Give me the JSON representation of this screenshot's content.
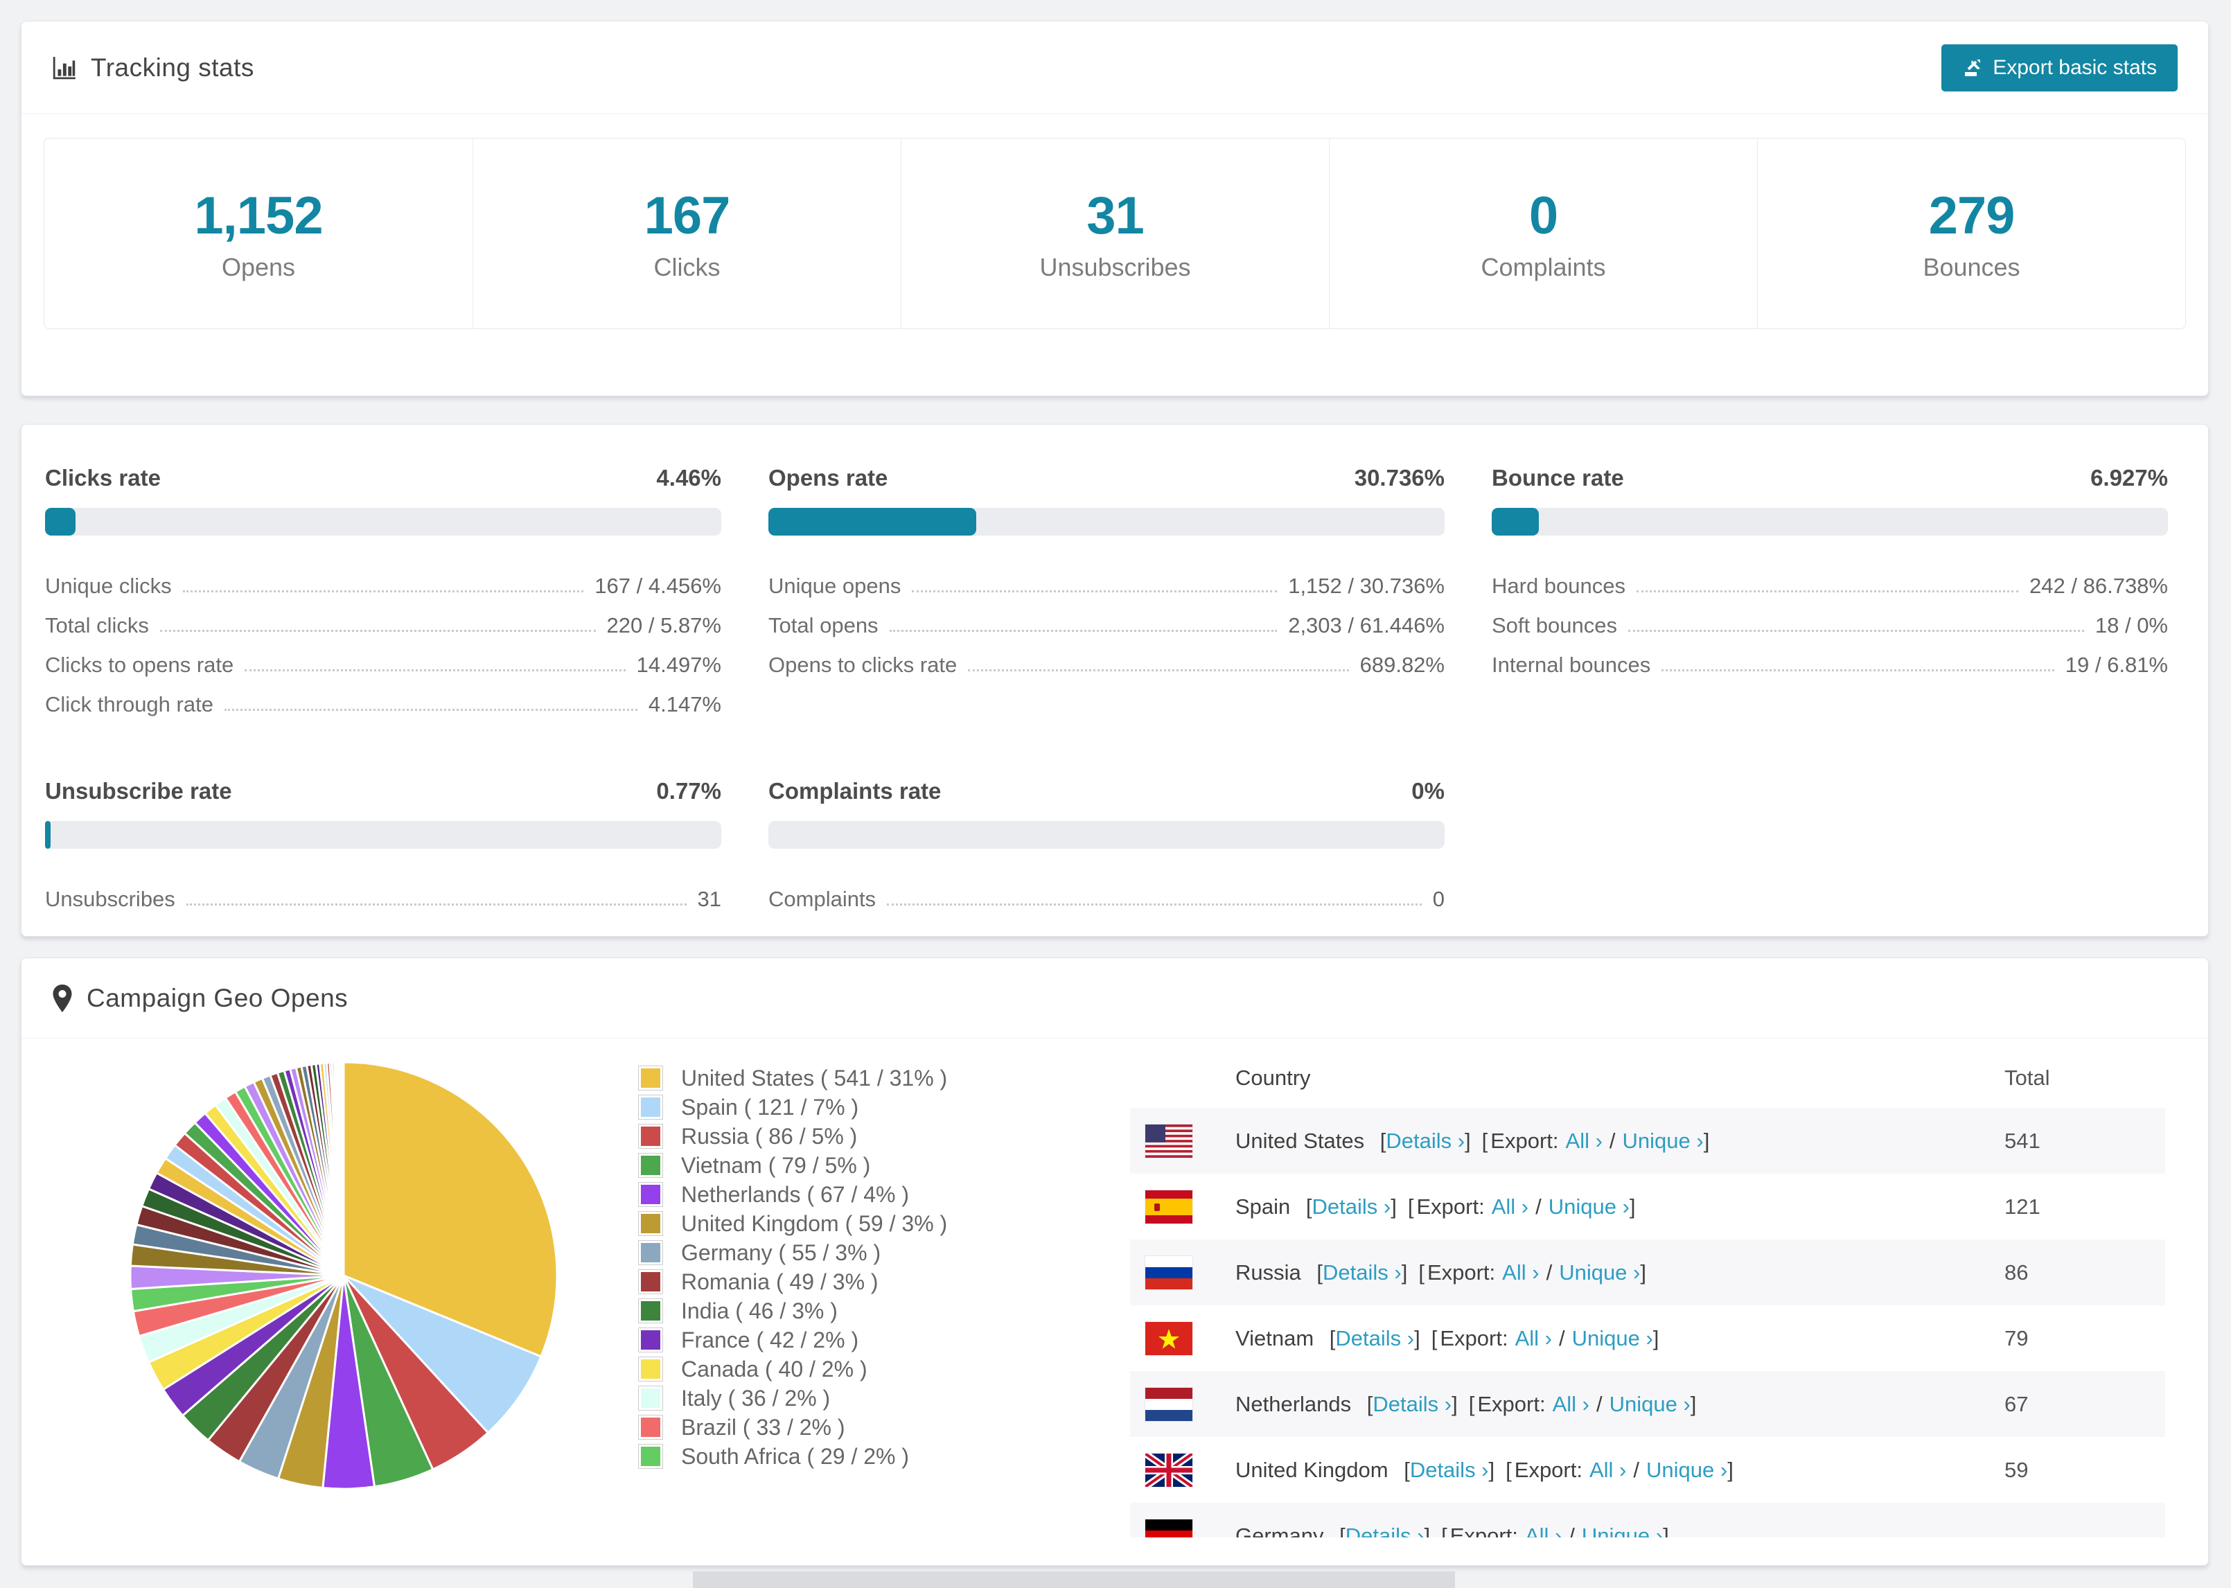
{
  "page": {
    "background": "#f1f2f4",
    "accent_color": "#1286a3",
    "link_color": "#2d9dc2"
  },
  "tracking": {
    "title": "Tracking stats",
    "icon": "bar-chart-icon",
    "export_button": "Export basic stats",
    "stats": [
      {
        "value": "1,152",
        "label": "Opens"
      },
      {
        "value": "167",
        "label": "Clicks"
      },
      {
        "value": "31",
        "label": "Unsubscribes"
      },
      {
        "value": "0",
        "label": "Complaints"
      },
      {
        "value": "279",
        "label": "Bounces"
      }
    ]
  },
  "rates": {
    "panels": [
      {
        "title": "Clicks rate",
        "value": "4.46%",
        "bar_pct": 4.46,
        "rows": [
          {
            "label": "Unique clicks",
            "value": "167 / 4.456%"
          },
          {
            "label": "Total clicks",
            "value": "220 / 5.87%"
          },
          {
            "label": "Clicks to opens rate",
            "value": "14.497%"
          },
          {
            "label": "Click through rate",
            "value": "4.147%"
          }
        ]
      },
      {
        "title": "Opens rate",
        "value": "30.736%",
        "bar_pct": 30.736,
        "rows": [
          {
            "label": "Unique opens",
            "value": "1,152 / 30.736%"
          },
          {
            "label": "Total opens",
            "value": "2,303 / 61.446%"
          },
          {
            "label": "Opens to clicks rate",
            "value": "689.82%"
          }
        ]
      },
      {
        "title": "Bounce rate",
        "value": "6.927%",
        "bar_pct": 6.927,
        "rows": [
          {
            "label": "Hard bounces",
            "value": "242 / 86.738%"
          },
          {
            "label": "Soft bounces",
            "value": "18 / 0%"
          },
          {
            "label": "Internal bounces",
            "value": "19 / 6.81%"
          }
        ]
      },
      {
        "title": "Unsubscribe rate",
        "value": "0.77%",
        "bar_pct": 0.77,
        "rows": [
          {
            "label": "Unsubscribes",
            "value": "31"
          }
        ]
      },
      {
        "title": "Complaints rate",
        "value": "0%",
        "bar_pct": 0,
        "rows": [
          {
            "label": "Complaints",
            "value": "0"
          }
        ]
      }
    ]
  },
  "geo": {
    "title": "Campaign Geo Opens",
    "icon": "map-pin-icon",
    "table": {
      "headers": {
        "country": "Country",
        "total": "Total"
      },
      "links": {
        "bracket_open": "[",
        "bracket_close": "]",
        "details": "Details ›",
        "export_prefix": "Export:",
        "all": "All ›",
        "slash": "/",
        "unique": "Unique ›"
      },
      "rows": [
        {
          "country": "United States",
          "flag": "us",
          "total": "541"
        },
        {
          "country": "Spain",
          "flag": "es",
          "total": "121"
        },
        {
          "country": "Russia",
          "flag": "ru",
          "total": "86"
        },
        {
          "country": "Vietnam",
          "flag": "vn",
          "total": "79"
        },
        {
          "country": "Netherlands",
          "flag": "nl",
          "total": "67"
        },
        {
          "country": "United Kingdom",
          "flag": "gb",
          "total": "59"
        },
        {
          "country": "Germany",
          "flag": "de",
          "total": ""
        }
      ]
    }
  },
  "chart_data": {
    "type": "pie",
    "title": "Campaign Geo Opens",
    "legend_position": "right",
    "start": "top",
    "direction": "clockwise",
    "series": [
      {
        "label": "United States",
        "value": 541,
        "pct": 31,
        "color": "#EDC240"
      },
      {
        "label": "Spain",
        "value": 121,
        "pct": 7,
        "color": "#AFD8F8"
      },
      {
        "label": "Russia",
        "value": 86,
        "pct": 5,
        "color": "#CB4B4B"
      },
      {
        "label": "Vietnam",
        "value": 79,
        "pct": 5,
        "color": "#4DA74D"
      },
      {
        "label": "Netherlands",
        "value": 67,
        "pct": 4,
        "color": "#9440ED"
      },
      {
        "label": "United Kingdom",
        "value": 59,
        "pct": 3,
        "color": "#BD9B33"
      },
      {
        "label": "Germany",
        "value": 55,
        "pct": 3,
        "color": "#8CA8C0"
      },
      {
        "label": "Romania",
        "value": 49,
        "pct": 3,
        "color": "#A23C3C"
      },
      {
        "label": "India",
        "value": 46,
        "pct": 3,
        "color": "#3D853D"
      },
      {
        "label": "France",
        "value": 42,
        "pct": 2,
        "color": "#7632BD"
      },
      {
        "label": "Canada",
        "value": 40,
        "pct": 2,
        "color": "#F7E14C"
      },
      {
        "label": "Italy",
        "value": 36,
        "pct": 2,
        "color": "#DCFEF4"
      },
      {
        "label": "Brazil",
        "value": 33,
        "pct": 2,
        "color": "#F26B6B"
      },
      {
        "label": "South Africa",
        "value": 29,
        "pct": 2,
        "color": "#63CC63"
      }
    ],
    "others_values": [
      30,
      28,
      26,
      25,
      24,
      23,
      22,
      21,
      20,
      19,
      18,
      17,
      16,
      15,
      14,
      13,
      12,
      11,
      10,
      9,
      8,
      8,
      7,
      7,
      6,
      6,
      5,
      5,
      4,
      4,
      3,
      3,
      2,
      2,
      2,
      1,
      1,
      1,
      1,
      1,
      1
    ],
    "others_palette": [
      "#BE8AF5",
      "#8F7526",
      "#5F7D96",
      "#7A2E2E",
      "#2E642E",
      "#58258D",
      "#EDC240",
      "#AFD8F8",
      "#CB4B4B",
      "#4DA74D",
      "#9440ED",
      "#F7E14C",
      "#DCFEF4",
      "#F26B6B",
      "#63CC63",
      "#BE8AF5",
      "#BD9B33",
      "#8CA8C0",
      "#A23C3C",
      "#3D853D",
      "#7632BD"
    ]
  }
}
